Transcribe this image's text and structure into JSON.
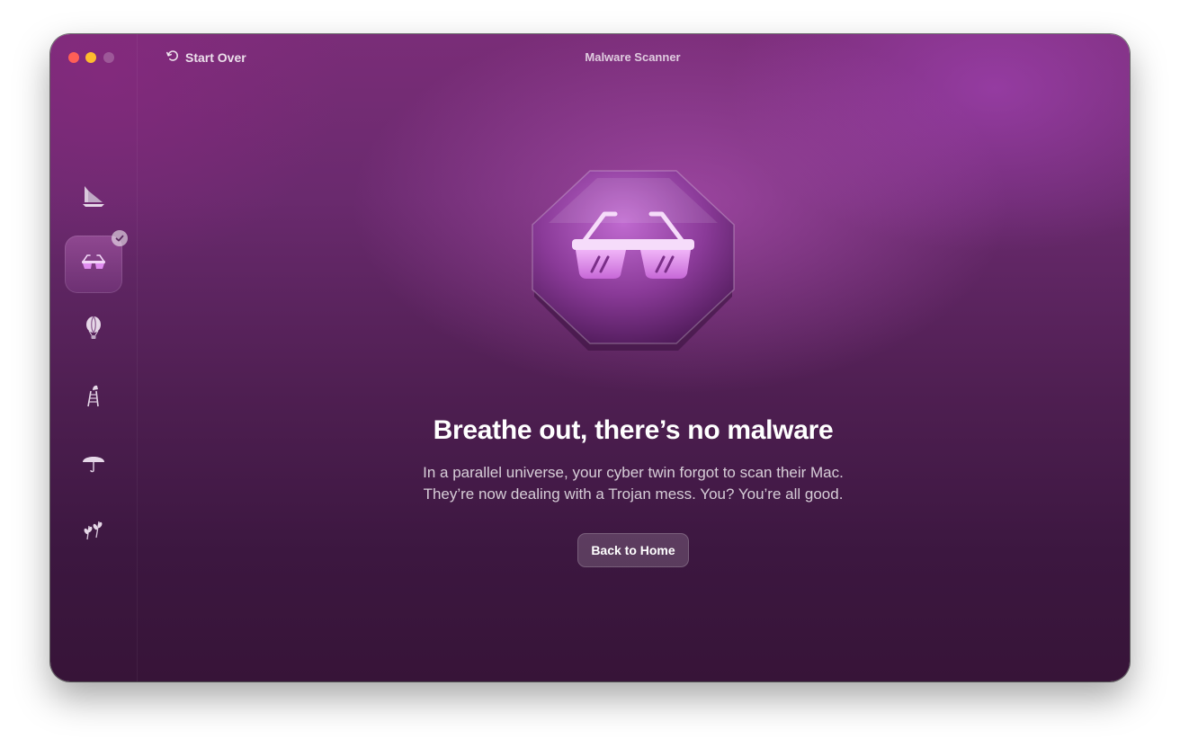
{
  "window": {
    "title": "Malware Scanner"
  },
  "toolbar": {
    "start_over_label": "Start Over",
    "start_over_icon": "rotate-left-icon"
  },
  "sidebar": {
    "items": [
      {
        "icon": "sailboat-icon",
        "active": false
      },
      {
        "icon": "sunglasses-icon",
        "active": true,
        "badge": "checkmark-icon"
      },
      {
        "icon": "hot-air-balloon-icon",
        "active": false
      },
      {
        "icon": "ladder-bird-icon",
        "active": false
      },
      {
        "icon": "umbrella-icon",
        "active": false
      },
      {
        "icon": "leaves-icon",
        "active": false
      }
    ]
  },
  "main": {
    "hero_icon": "sunglasses-shield-icon",
    "headline": "Breathe out, there’s no malware",
    "subtext_line1": "In a parallel universe, your cyber twin forgot to scan their Mac.",
    "subtext_line2": "They’re now dealing with a Trojan mess. You? You’re all good.",
    "back_button_label": "Back to Home"
  },
  "colors": {
    "close": "#fe5f57",
    "minimize": "#febc2e",
    "accent": "#e08cf0",
    "background_top": "#7a2d78",
    "background_bottom": "#371438"
  }
}
